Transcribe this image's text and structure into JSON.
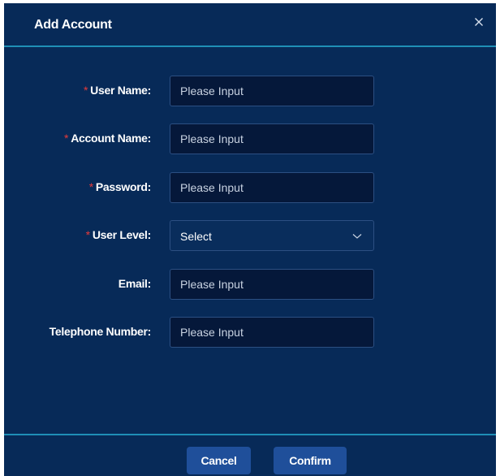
{
  "dialog": {
    "title": "Add Account",
    "close_glyph": "×"
  },
  "form": {
    "required_mark": "*",
    "user_name": {
      "label": "User Name:",
      "placeholder": "Please Input",
      "required": true
    },
    "account_name": {
      "label": "Account Name:",
      "placeholder": "Please Input",
      "required": true
    },
    "password": {
      "label": "Password:",
      "placeholder": "Please Input",
      "required": true
    },
    "user_level": {
      "label": "User Level:",
      "value": "Select",
      "required": true
    },
    "email": {
      "label": "Email:",
      "placeholder": "Please Input",
      "required": false
    },
    "telephone": {
      "label": "Telephone Number:",
      "placeholder": "Please Input",
      "required": false
    }
  },
  "footer": {
    "cancel_label": "Cancel",
    "confirm_label": "Confirm"
  },
  "icons": {
    "close": "close-icon",
    "dropdown": "chevron-down-icon"
  },
  "colors": {
    "background": "#072a58",
    "divider": "#1f8fb6",
    "required": "#e63a3a",
    "button": "#1f4f9a"
  }
}
